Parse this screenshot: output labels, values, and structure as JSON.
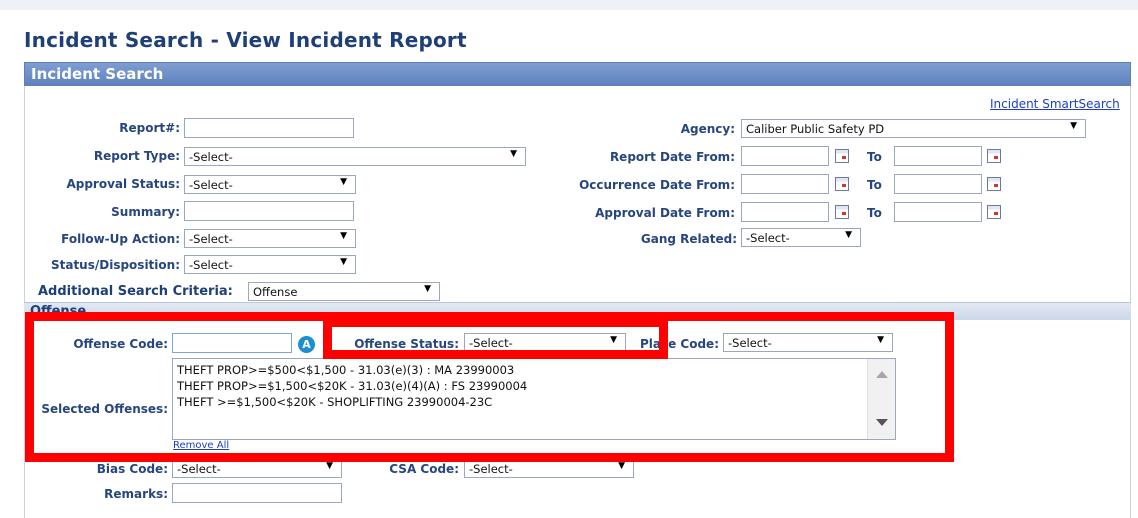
{
  "page_title": "Incident Search - View Incident Report",
  "panel_title": "Incident Search",
  "smart_search_link": "Incident SmartSearch",
  "fields": {
    "report_no": {
      "label": "Report#:",
      "value": ""
    },
    "report_type": {
      "label": "Report Type:",
      "value": "-Select-"
    },
    "approval_status": {
      "label": "Approval Status:",
      "value": "-Select-"
    },
    "summary": {
      "label": "Summary:",
      "value": ""
    },
    "follow_up_action": {
      "label": "Follow-Up Action:",
      "value": "-Select-"
    },
    "status_disposition": {
      "label": "Status/Disposition:",
      "value": "-Select-"
    },
    "agency": {
      "label": "Agency:",
      "value": "Caliber Public Safety PD"
    },
    "report_date_from": {
      "label": "Report Date From:",
      "value": "",
      "to_label": "To",
      "to_value": ""
    },
    "occurrence_date_from": {
      "label": "Occurrence Date From:",
      "value": "",
      "to_label": "To",
      "to_value": ""
    },
    "approval_date_from": {
      "label": "Approval Date From:",
      "value": "",
      "to_label": "To",
      "to_value": ""
    },
    "gang_related": {
      "label": "Gang Related:",
      "value": "-Select-"
    }
  },
  "additional_criteria": {
    "label": "Additional Search Criteria:",
    "value": "Offense"
  },
  "offense_panel": {
    "title": "Offense",
    "offense_code": {
      "label": "Offense Code:",
      "value": "",
      "badge": "A"
    },
    "offense_status": {
      "label": "Offense Status:",
      "value": "-Select-"
    },
    "place_code": {
      "label": "Place Code:",
      "value": "-Select-"
    },
    "selected_offenses": {
      "label": "Selected Offenses:",
      "items": [
        "THEFT PROP>=$500<$1,500 - 31.03(e)(3) : MA 23990003",
        "THEFT PROP>=$1,500<$20K - 31.03(e)(4)(A) : FS 23990004",
        "THEFT >=$1,500<$20K - SHOPLIFTING 23990004-23C"
      ]
    },
    "remove_all": "Remove All",
    "bias_code": {
      "label": "Bias Code:",
      "value": "-Select-"
    },
    "csa_code": {
      "label": "CSA Code:",
      "value": "-Select-"
    },
    "remarks": {
      "label": "Remarks:",
      "value": ""
    }
  },
  "colors": {
    "highlight": "#ff0000",
    "header_blue": "#6f8fc8",
    "label_blue": "#27457e"
  }
}
